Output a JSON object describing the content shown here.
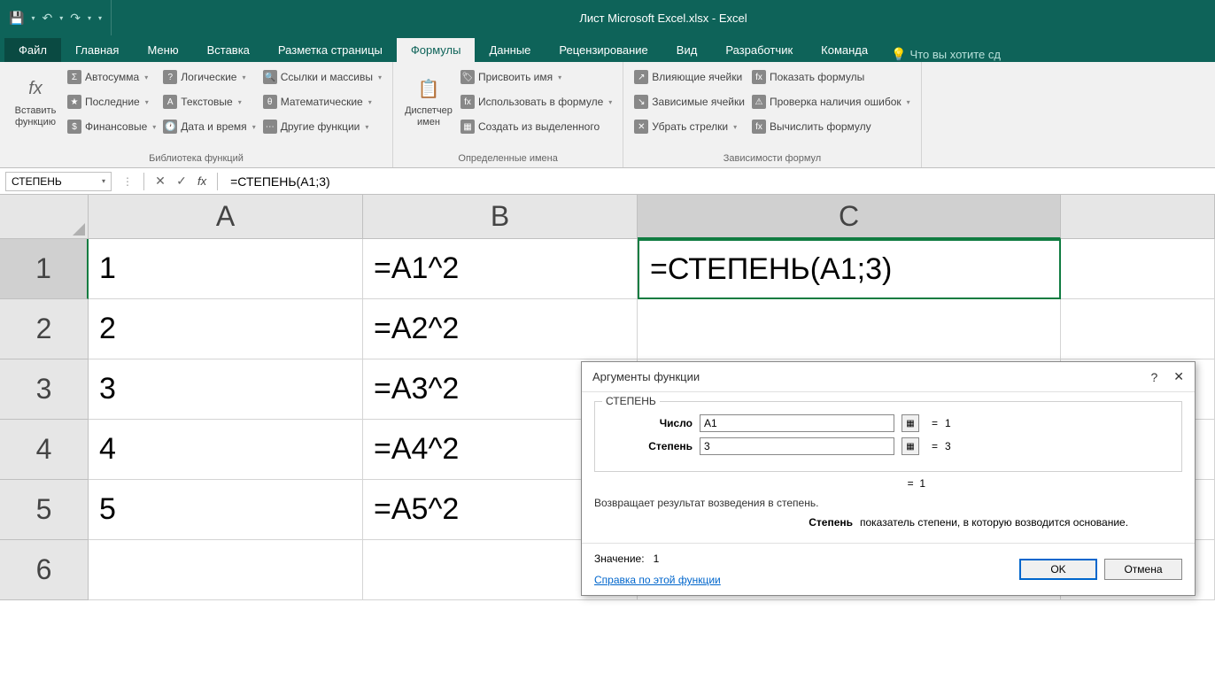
{
  "titlebar": {
    "title": "Лист Microsoft Excel.xlsx - Excel"
  },
  "tabs": {
    "file": "Файл",
    "home": "Главная",
    "menu": "Меню",
    "insert": "Вставка",
    "layout": "Разметка страницы",
    "formulas": "Формулы",
    "data": "Данные",
    "review": "Рецензирование",
    "view": "Вид",
    "developer": "Разработчик",
    "team": "Команда",
    "tellme": "Что вы хотите сд"
  },
  "ribbon": {
    "insert_fn": "Вставить функцию",
    "autosum": "Автосумма",
    "recent": "Последние",
    "financial": "Финансовые",
    "logical": "Логические",
    "text": "Текстовые",
    "datetime": "Дата и время",
    "lookup": "Ссылки и массивы",
    "math": "Математические",
    "other": "Другие функции",
    "group_lib": "Библиотека функций",
    "name_mgr": "Диспетчер имен",
    "define_name": "Присвоить имя",
    "use_in_formula": "Использовать в формуле",
    "create_from_sel": "Создать из выделенного",
    "group_names": "Определенные имена",
    "trace_prec": "Влияющие ячейки",
    "trace_dep": "Зависимые ячейки",
    "remove_arrows": "Убрать стрелки",
    "show_formulas": "Показать формулы",
    "error_check": "Проверка наличия ошибок",
    "eval_formula": "Вычислить формулу",
    "group_audit": "Зависимости формул"
  },
  "formula_bar": {
    "name_box": "СТЕПЕНЬ",
    "formula": "=СТЕПЕНЬ(A1;3)"
  },
  "columns": {
    "A": "A",
    "B": "B",
    "C": "C"
  },
  "rows": [
    "1",
    "2",
    "3",
    "4",
    "5",
    "6"
  ],
  "cells": {
    "A1": "1",
    "A2": "2",
    "A3": "3",
    "A4": "4",
    "A5": "5",
    "B1": "=A1^2",
    "B2": "=A2^2",
    "B3": "=A3^2",
    "B4": "=A4^2",
    "B5": "=A5^2",
    "C1": "=СТЕПЕНЬ(A1;3)"
  },
  "dialog": {
    "title": "Аргументы функции",
    "fn_name": "СТЕПЕНЬ",
    "arg1_label": "Число",
    "arg1_value": "A1",
    "arg1_result": "1",
    "arg2_label": "Степень",
    "arg2_value": "3",
    "arg2_result": "3",
    "preview_result": "1",
    "description": "Возвращает результат возведения в степень.",
    "param_name": "Степень",
    "param_desc": "показатель степени, в которую возводится основание.",
    "value_label": "Значение:",
    "value_result": "1",
    "help": "Справка по этой функции",
    "ok": "OK",
    "cancel": "Отмена"
  }
}
